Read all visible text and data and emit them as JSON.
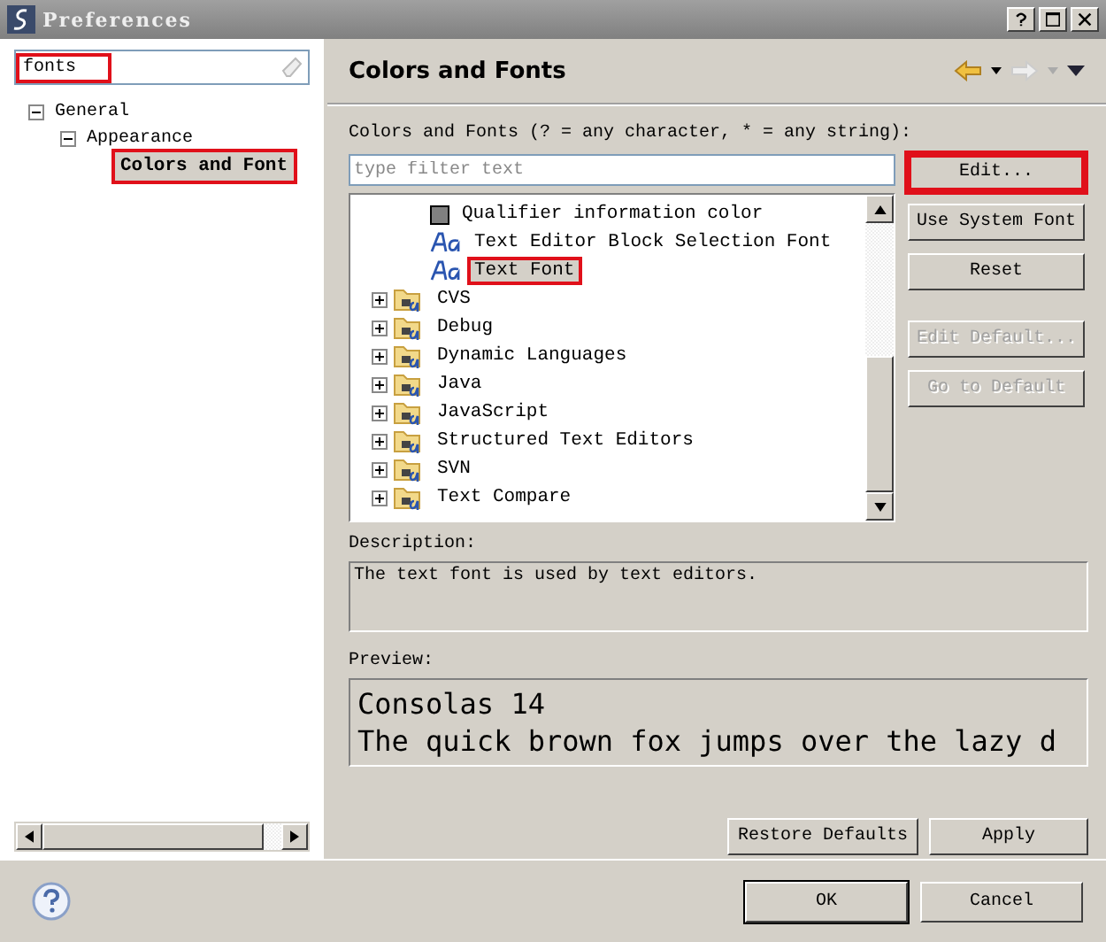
{
  "window": {
    "title": "Preferences"
  },
  "filter": {
    "value": "fonts",
    "highlighted": true
  },
  "nav_tree": [
    {
      "label": "General",
      "expanded": true,
      "children": [
        {
          "label": "Appearance",
          "expanded": true,
          "children": [
            {
              "label": "Colors and Font",
              "selected": true,
              "highlighted": true
            }
          ]
        }
      ]
    }
  ],
  "page": {
    "title": "Colors and Fonts",
    "filter_label": "Colors and Fonts (? = any character, * = any string):",
    "filter_placeholder": "type filter text"
  },
  "items": [
    {
      "kind": "color",
      "label": "Qualifier information color",
      "selected": false,
      "highlighted": false,
      "color": "#808080"
    },
    {
      "kind": "font",
      "label": "Text Editor Block Selection Font",
      "selected": false,
      "highlighted": false
    },
    {
      "kind": "font",
      "label": "Text Font",
      "selected": true,
      "highlighted": true
    },
    {
      "kind": "category",
      "label": "CVS",
      "expanded": false
    },
    {
      "kind": "category",
      "label": "Debug",
      "expanded": false
    },
    {
      "kind": "category",
      "label": "Dynamic Languages",
      "expanded": false
    },
    {
      "kind": "category",
      "label": "Java",
      "expanded": false
    },
    {
      "kind": "category",
      "label": "JavaScript",
      "expanded": false
    },
    {
      "kind": "category",
      "label": "Structured Text Editors",
      "expanded": false
    },
    {
      "kind": "category",
      "label": "SVN",
      "expanded": false
    },
    {
      "kind": "category",
      "label": "Text Compare",
      "expanded": false
    }
  ],
  "side_buttons": [
    {
      "label": "Edit...",
      "disabled": false,
      "highlighted": true
    },
    {
      "label": "Use System Font",
      "disabled": false,
      "highlighted": false
    },
    {
      "label": "Reset",
      "disabled": false,
      "highlighted": false
    },
    {
      "label": "Edit Default...",
      "disabled": true,
      "highlighted": false
    },
    {
      "label": "Go to Default",
      "disabled": true,
      "highlighted": false
    }
  ],
  "description": {
    "label": "Description:",
    "text": "The text font is used by text editors."
  },
  "preview": {
    "label": "Preview:",
    "lines": [
      "Consolas 14",
      "The quick brown fox jumps over the lazy d"
    ]
  },
  "page_buttons": [
    "Restore Defaults",
    "Apply"
  ],
  "dialog_buttons": [
    "OK",
    "Cancel"
  ]
}
